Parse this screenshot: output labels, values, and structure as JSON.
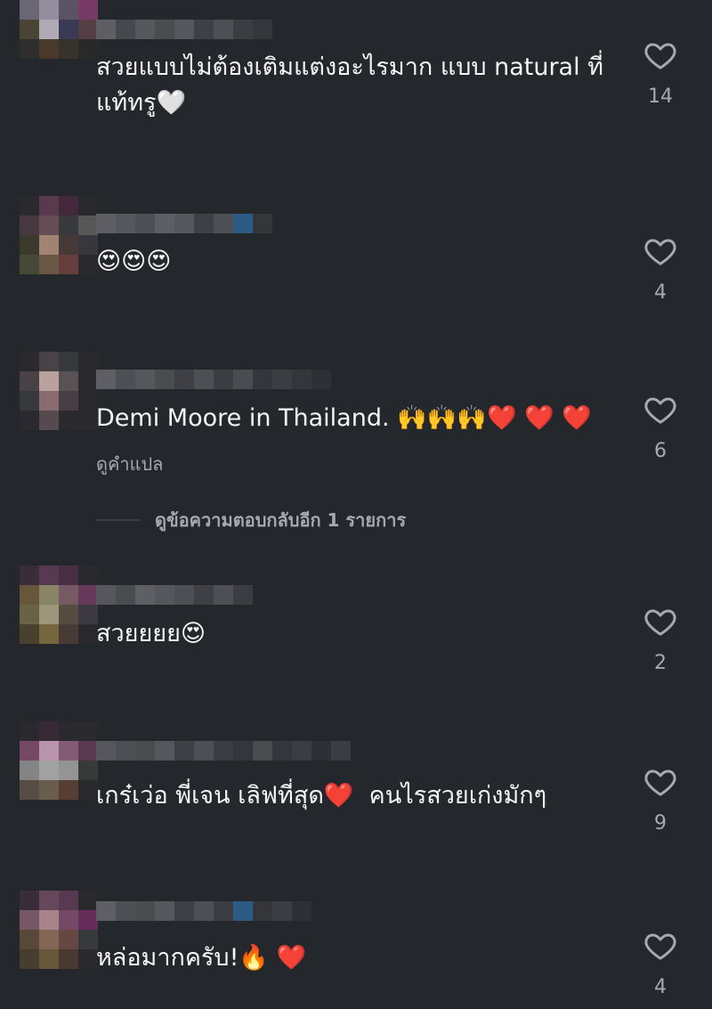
{
  "comments": [
    {
      "text": "สวยแบบไม่ต้องเติมแต่งอะไรมาก แบบ natural ที่แท้ทรู🤍",
      "likes": "14",
      "like_label": "like"
    },
    {
      "text": "😍😍😍",
      "likes": "4"
    },
    {
      "text": "Demi Moore in Thailand. 🙌🙌🙌❤️ ❤️ ❤️",
      "translate": "ดูคำแปล",
      "likes": "6",
      "replies": "ดูข้อความตอบกลับอีก 1 รายการ"
    },
    {
      "text": "สวยยยย😍",
      "likes": "2"
    },
    {
      "text": "เกร๋เว่อ พี่เจน เลิฟที่สุด❤️  คนไรสวยเก่งมักๆ",
      "likes": "9"
    },
    {
      "text": "หล่อมากครับ!🔥 ❤️",
      "likes": "4"
    }
  ],
  "colors": {
    "background": "#24272c",
    "text": "#f5f5f5",
    "secondary": "#a6a9ae"
  },
  "icons": {
    "like": "heart-outline-icon",
    "avatar": "pixelated-avatar",
    "username": "pixelated-username"
  }
}
